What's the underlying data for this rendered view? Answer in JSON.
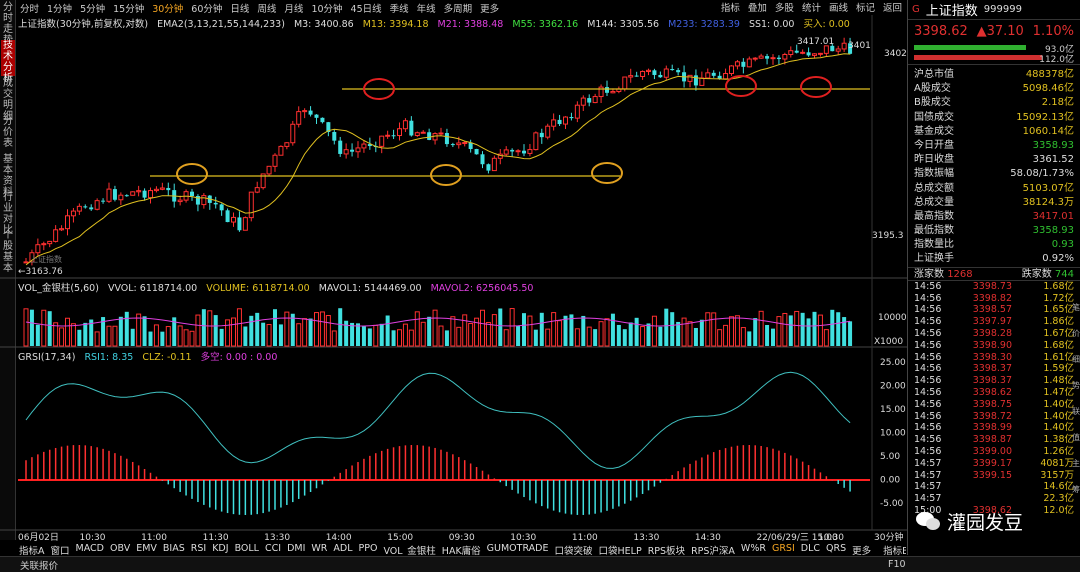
{
  "left_tabs": [
    "分时走势",
    "技术分析",
    "成交明细",
    "分价表",
    "基本资料",
    "行业对比",
    "个股基本"
  ],
  "active_left_tab": 1,
  "periods": [
    "分时",
    "1分钟",
    "5分钟",
    "15分钟",
    "30分钟",
    "60分钟",
    "日线",
    "周线",
    "月线",
    "10分钟",
    "45日线",
    "季线",
    "年线",
    "多周期",
    "更多"
  ],
  "active_period": 4,
  "right_tools": [
    "指标",
    "叠加",
    "多股",
    "统计",
    "画线",
    "标记",
    "返回"
  ],
  "ma_line": {
    "title": "上证指数(30分钟,前复权,对数)",
    "ema": "EMA2(3,13,21,55,144,233)",
    "m3": "M3: 3400.86",
    "m13": "M13: 3394.18",
    "m21": "M21: 3388.48",
    "m55": "M55: 3362.16",
    "m144": "M144: 3305.56",
    "m233": "M233: 3283.39",
    "ss1": "SS1: 0.00",
    "buy": "买入: 0.00"
  },
  "price_labels": {
    "high": "3417.01",
    "right_tag": "3401",
    "axis_top": "3402",
    "axis_mid": "3195.3",
    "low": "←3163.76",
    "center_note": "上证指数"
  },
  "vol_line": {
    "title": "VOL_金银柱(5,60)",
    "vvol": "VVOL: 6118714.00",
    "volume": "VOLUME: 6118714.00",
    "mavol1": "MAVOL1: 5144469.00",
    "mavol2": "MAVOL2: 6256045.50",
    "axis_a": "10000",
    "axis_b": "X1000"
  },
  "grsi_line": {
    "title": "GRSI(17,34)",
    "rsi1": "RSI1: 8.35",
    "clz": "CLZ: -0.11",
    "kong": "多空: 0.00 : 0.00"
  },
  "grsi_axis": [
    "25.00",
    "20.00",
    "15.00",
    "10.00",
    "5.00",
    "0.00",
    "-5.00"
  ],
  "time_axis": [
    "06月02日",
    "10:30",
    "11:00",
    "11:30",
    "13:30",
    "14:00",
    "15:00",
    "09:30",
    "10:30",
    "11:00",
    "13:30",
    "14:30",
    "22/06/29/三 15:00",
    "10:30",
    "30分钟"
  ],
  "quote": {
    "flag": "G",
    "name": "上证指数",
    "code": "999999",
    "price": "3398.62",
    "change": "▲37.10",
    "pct": "1.10%",
    "bar1": "93.0亿",
    "bar2": "112.0亿"
  },
  "stats": [
    [
      "沪总市值",
      "488378亿"
    ],
    [
      "A股成交",
      "5098.46亿"
    ],
    [
      "B股成交",
      "2.18亿"
    ],
    [
      "国债成交",
      "15092.13亿"
    ],
    [
      "基金成交",
      "1060.14亿"
    ],
    [
      "今日开盘",
      "3358.93"
    ],
    [
      "昨日收盘",
      "3361.52"
    ],
    [
      "指数振幅",
      "58.08/1.73%"
    ],
    [
      "总成交额",
      "5103.07亿"
    ],
    [
      "总成交量",
      "38124.3万"
    ],
    [
      "最高指数",
      "3417.01"
    ],
    [
      "最低指数",
      "3358.93"
    ],
    [
      "指数量比",
      "0.93"
    ],
    [
      "上证换手",
      "0.92%"
    ]
  ],
  "updown": {
    "up_label": "涨家数",
    "up": "1268",
    "down_label": "跌家数",
    "down": "744"
  },
  "ticks": [
    [
      "14:56",
      "3398.73",
      "1.68亿"
    ],
    [
      "14:56",
      "3398.82",
      "1.72亿"
    ],
    [
      "14:56",
      "3398.57",
      "1.65亿"
    ],
    [
      "14:56",
      "3397.97",
      "1.86亿"
    ],
    [
      "14:56",
      "3398.28",
      "1.67亿"
    ],
    [
      "14:56",
      "3398.90",
      "1.68亿"
    ],
    [
      "14:56",
      "3398.30",
      "1.61亿"
    ],
    [
      "14:56",
      "3398.37",
      "1.59亿"
    ],
    [
      "14:56",
      "3398.37",
      "1.48亿"
    ],
    [
      "14:56",
      "3398.62",
      "1.47亿"
    ],
    [
      "14:56",
      "3398.75",
      "1.40亿"
    ],
    [
      "14:56",
      "3398.72",
      "1.40亿"
    ],
    [
      "14:56",
      "3398.99",
      "1.40亿"
    ],
    [
      "14:56",
      "3398.87",
      "1.38亿"
    ],
    [
      "14:56",
      "3399.00",
      "1.26亿"
    ],
    [
      "14:57",
      "3399.17",
      "4081万"
    ],
    [
      "14:57",
      "3399.15",
      "3157万"
    ],
    [
      "14:57",
      "",
      "14.6亿"
    ],
    [
      "14:57",
      "",
      "22.3亿"
    ],
    [
      "15:00",
      "3398.62",
      "12.0亿"
    ]
  ],
  "bottom_tabs": [
    "指标A",
    "窗口",
    "MACD",
    "OBV",
    "EMV",
    "BIAS",
    "RSI",
    "KDJ",
    "BOLL",
    "CCI",
    "DMI",
    "WR",
    "ADL",
    "PPO",
    "VOL_金银柱",
    "HAK庸俗",
    "GUMOTRADE",
    "口袋突破",
    "口袋HELP",
    "RPS板块",
    "RPS沪深A",
    "W%R",
    "GRSI",
    "DLC",
    "QRS",
    "更多"
  ],
  "active_bottom": 22,
  "bottom_right": [
    "指标B",
    "模",
    "板"
  ],
  "status_text": "关联报价",
  "status_right": "F10",
  "side_tabs": [
    "笔",
    "价",
    "细",
    "势",
    "联",
    "值",
    "主",
    "筹"
  ],
  "watermark": "灌园发豆"
}
